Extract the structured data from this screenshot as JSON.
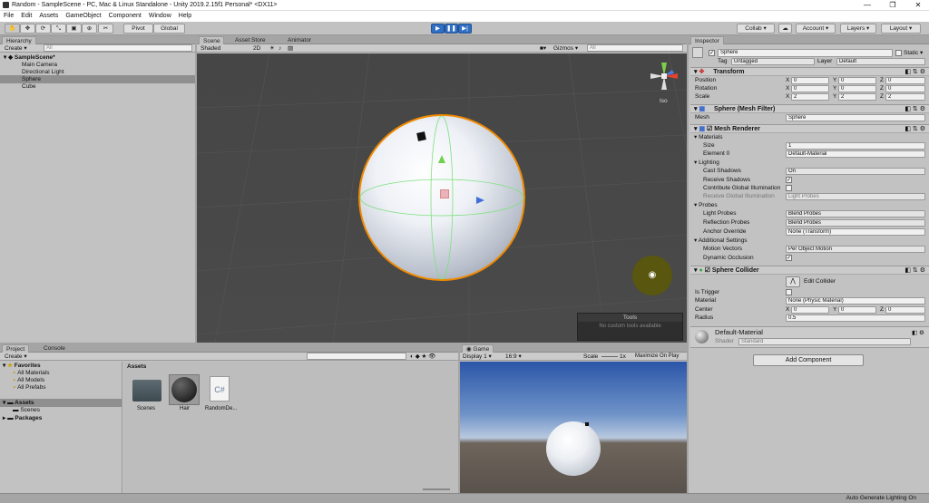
{
  "window": {
    "title": "Random - SampleScene - PC, Mac & Linux Standalone - Unity 2019.2.15f1 Personal* <DX11>"
  },
  "menu": [
    "File",
    "Edit",
    "Assets",
    "GameObject",
    "Component",
    "Window",
    "Help"
  ],
  "toolbar": {
    "pivot": "Pivot",
    "global": "Global",
    "collab": "Collab ▾",
    "account": "Account ▾",
    "layers": "Layers ▾",
    "layout": "Layout ▾"
  },
  "hierarchy": {
    "tab": "Hierarchy",
    "create": "Create ▾",
    "search_placeholder": "All",
    "scene": "SampleScene*",
    "items": [
      "Main Camera",
      "Directional Light",
      "Sphere",
      "Cube"
    ]
  },
  "scene": {
    "tabs": [
      "Scene",
      "Asset Store",
      "Animator"
    ],
    "shading": "Shaded",
    "mode": "2D",
    "gizmos": "Gizmos ▾",
    "search_placeholder": "All",
    "iso": "Iso",
    "tools_title": "Tools",
    "tools_message": "No custom tools available"
  },
  "inspector": {
    "tab": "Inspector",
    "object_name": "Sphere",
    "static": "Static ▾",
    "tag_label": "Tag",
    "tag": "Untagged",
    "layer_label": "Layer",
    "layer": "Default",
    "transform": {
      "title": "Transform",
      "rows": [
        {
          "label": "Position",
          "x": "0",
          "y": "0",
          "z": "0"
        },
        {
          "label": "Rotation",
          "x": "0",
          "y": "0",
          "z": "0"
        },
        {
          "label": "Scale",
          "x": "2",
          "y": "2",
          "z": "2"
        }
      ]
    },
    "mesh_filter": {
      "title": "Sphere (Mesh Filter)",
      "mesh_label": "Mesh",
      "mesh": "Sphere"
    },
    "mesh_renderer": {
      "title": "Mesh Renderer",
      "materials": "Materials",
      "size_label": "Size",
      "size": "1",
      "element_label": "Element 0",
      "element": "Default-Material",
      "lighting": "Lighting",
      "cast_label": "Cast Shadows",
      "cast": "On",
      "receive_label": "Receive Shadows",
      "contribute_label": "Contribute Global Illumination",
      "receive_gi_label": "Receive Global Illumination",
      "receive_gi": "Light Probes",
      "probes": "Probes",
      "light_probes_label": "Light Probes",
      "light_probes": "Blend Probes",
      "reflection_label": "Reflection Probes",
      "reflection": "Blend Probes",
      "anchor_label": "Anchor Override",
      "anchor": "None (Transform)",
      "additional": "Additional Settings",
      "motion_label": "Motion Vectors",
      "motion": "Per Object Motion",
      "occlusion_label": "Dynamic Occlusion"
    },
    "sphere_collider": {
      "title": "Sphere Collider",
      "edit": "Edit Collider",
      "trigger_label": "Is Trigger",
      "material_label": "Material",
      "material": "None (Physic Material)",
      "center_label": "Center",
      "cx": "0",
      "cy": "0",
      "cz": "0",
      "radius_label": "Radius",
      "radius": "0.5"
    },
    "material": {
      "name": "Default-Material",
      "shader_label": "Shader",
      "shader": "Standard"
    },
    "add_component": "Add Component"
  },
  "project": {
    "tabs": [
      "Project",
      "Console"
    ],
    "create": "Create ▾",
    "favorites": "Favorites",
    "fav_items": [
      "All Materials",
      "All Models",
      "All Prefabs"
    ],
    "assets": "Assets",
    "scenes": "Scenes",
    "packages": "Packages",
    "breadcrumb": "Assets",
    "files": [
      "Scenes",
      "Hair",
      "RandomDe..."
    ]
  },
  "game": {
    "tab": "Game",
    "display": "Display 1 ▾",
    "aspect": "16:9 ▾",
    "scale_label": "Scale",
    "scale": "1x",
    "maximize": "Maximize On Play"
  },
  "status": {
    "text": "Auto Generate Lighting On"
  }
}
